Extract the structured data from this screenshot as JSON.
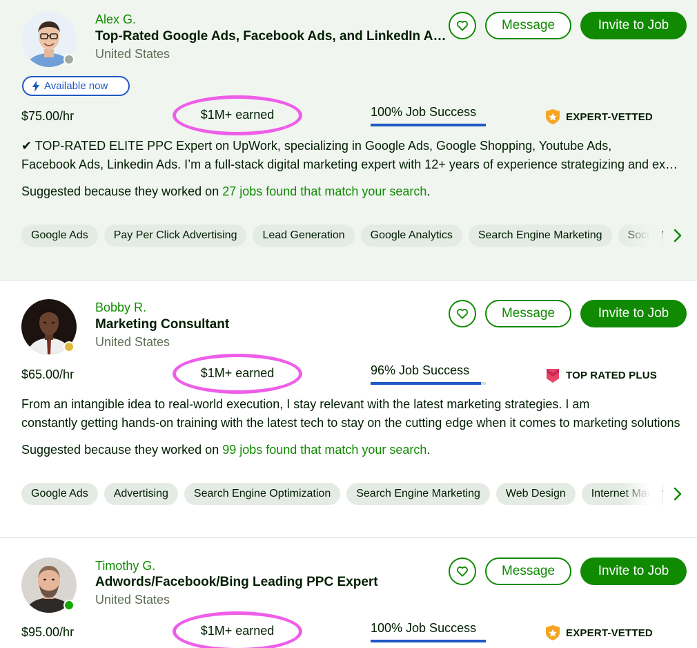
{
  "colors": {
    "brand_green": "#108a00",
    "job_success_blue": "#1f57c3",
    "annotation_pink": "#ee5ee8"
  },
  "cards": [
    {
      "name": "Alex G.",
      "title": "Top-Rated Google Ads, Facebook Ads, and LinkedIn Ads Expert",
      "location": "United States",
      "status_color": "#a0aa9f",
      "available_label": "Available now",
      "rate": "$75.00/hr",
      "earned": "$1M+ earned",
      "job_success": "100% Job Success",
      "job_success_pct": 100,
      "badge": "EXPERT-VETTED",
      "badge_icon": "expert-vetted-icon",
      "desc_line1": "✔ TOP-RATED ELITE PPC Expert on UpWork, specializing in Google Ads, Google Shopping, Youtube Ads,",
      "desc_line2": "Facebook Ads, Linkedin Ads. I’m a full-stack digital marketing expert with 12+ years of experience strategizing and executing",
      "suggest_prefix": "Suggested because they worked on",
      "suggest_link": "27 jobs found that match your search",
      "suggest_suffix": ".",
      "skills": [
        "Google Ads",
        "Pay Per Click Advertising",
        "Lead Generation",
        "Google Analytics",
        "Search Engine Marketing",
        "Social Media Marketing"
      ],
      "message_label": "Message",
      "invite_label": "Invite to Job"
    },
    {
      "name": "Bobby R.",
      "title": "Marketing Consultant",
      "location": "United States",
      "status_color": "#e0b93a",
      "rate": "$65.00/hr",
      "earned": "$1M+ earned",
      "job_success": "96% Job Success",
      "job_success_pct": 96,
      "badge": "TOP RATED PLUS",
      "badge_icon": "top-rated-plus-icon",
      "desc_line1": "From an intangible idea to real-world execution, I stay relevant with the latest marketing strategies. I am",
      "desc_line2": "constantly getting hands-on training with the latest tech to stay on the cutting edge when it comes to marketing solutions",
      "suggest_prefix": "Suggested because they worked on",
      "suggest_link": "99 jobs found that match your search",
      "suggest_suffix": ".",
      "skills": [
        "Google Ads",
        "Advertising",
        "Search Engine Optimization",
        "Search Engine Marketing",
        "Web Design",
        "Internet Marketing"
      ],
      "message_label": "Message",
      "invite_label": "Invite to Job"
    },
    {
      "name": "Timothy G.",
      "title": "Adwords/Facebook/Bing Leading PPC Expert",
      "location": "United States",
      "status_color": "#14a800",
      "rate": "$95.00/hr",
      "earned": "$1M+ earned",
      "job_success": "100% Job Success",
      "job_success_pct": 100,
      "badge": "EXPERT-VETTED",
      "badge_icon": "expert-vetted-icon",
      "message_label": "Message",
      "invite_label": "Invite to Job"
    }
  ]
}
